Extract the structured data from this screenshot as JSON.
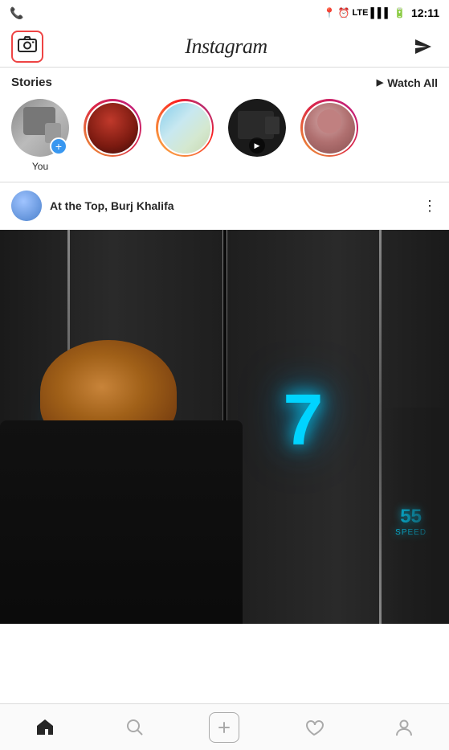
{
  "status_bar": {
    "time": "12:11",
    "signal": "LTE",
    "battery": "🔋"
  },
  "header": {
    "logo": "Instagram",
    "camera_label": "camera",
    "send_label": "send"
  },
  "stories": {
    "title": "Stories",
    "watch_all": "Watch All",
    "items": [
      {
        "id": "you",
        "label": "You",
        "has_add": true,
        "has_ring": false,
        "av_class": "av-you"
      },
      {
        "id": "s1",
        "label": "",
        "has_ring": true,
        "ring_class": "gradient",
        "av_class": "av-1"
      },
      {
        "id": "s2",
        "label": "",
        "has_ring": true,
        "ring_class": "gradient-orange",
        "av_class": "av-2"
      },
      {
        "id": "s3",
        "label": "",
        "has_ring": false,
        "ring_class": "no-ring",
        "av_class": "av-3",
        "has_video": true
      },
      {
        "id": "s4",
        "label": "",
        "has_ring": true,
        "ring_class": "gradient",
        "av_class": "av-4"
      }
    ]
  },
  "post": {
    "author": "At the Top, Burj Khalifa",
    "image_alt": "Elevator scene at Burj Khalifa"
  },
  "nav": {
    "items": [
      {
        "id": "home",
        "icon": "🏠",
        "active": true
      },
      {
        "id": "search",
        "icon": "🔍",
        "active": false
      },
      {
        "id": "add",
        "icon": "+",
        "active": false
      },
      {
        "id": "heart",
        "icon": "♡",
        "active": false
      },
      {
        "id": "profile",
        "icon": "👤",
        "active": false
      }
    ]
  }
}
